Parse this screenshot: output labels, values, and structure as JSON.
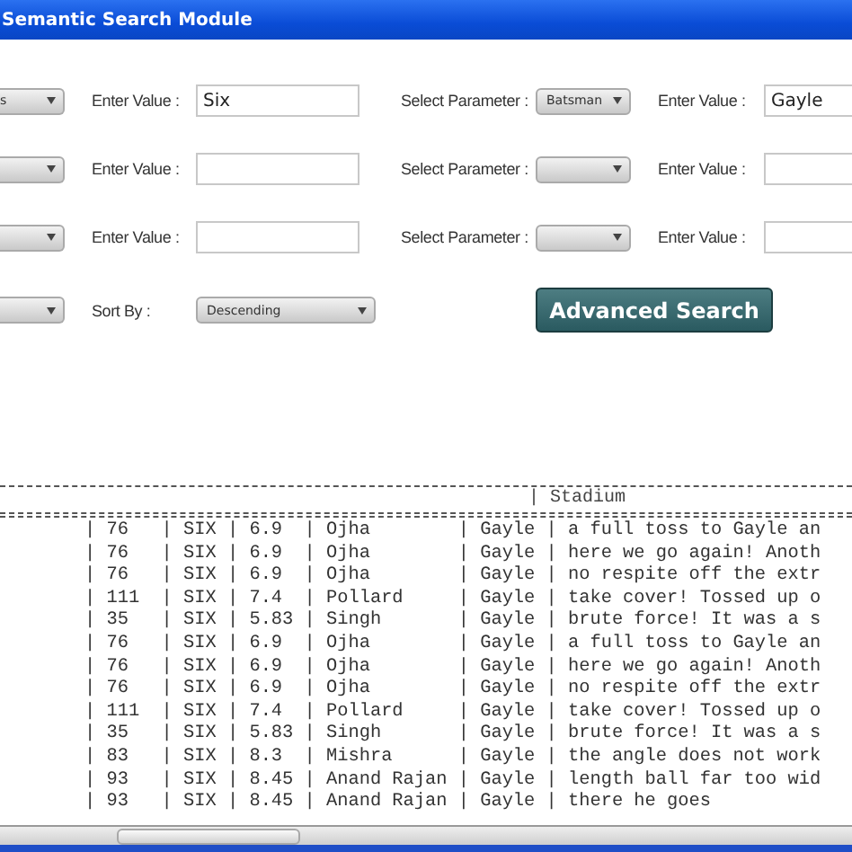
{
  "window": {
    "title": "Semantic Search Module"
  },
  "criteria_rows": [
    {
      "cells": [
        {
          "kind": "edge_dropdown",
          "value": "s"
        },
        {
          "kind": "label",
          "text": "Enter Value :"
        },
        {
          "kind": "input",
          "value": "Six"
        },
        {
          "kind": "label",
          "text": "Select Parameter :"
        },
        {
          "kind": "dropdown",
          "value": "Batsman"
        },
        {
          "kind": "label",
          "text": "Enter Value :"
        },
        {
          "kind": "input",
          "value": "Gayle"
        }
      ]
    },
    {
      "cells": [
        {
          "kind": "edge_dropdown"
        },
        {
          "kind": "label",
          "text": "Enter Value :"
        },
        {
          "kind": "input"
        },
        {
          "kind": "label",
          "text": "Select Parameter :"
        },
        {
          "kind": "dropdown"
        },
        {
          "kind": "label",
          "text": "Enter Value :"
        },
        {
          "kind": "input"
        }
      ]
    },
    {
      "cells": [
        {
          "kind": "edge_dropdown"
        },
        {
          "kind": "label",
          "text": "Enter Value :"
        },
        {
          "kind": "input"
        },
        {
          "kind": "label",
          "text": "Select Parameter :"
        },
        {
          "kind": "dropdown"
        },
        {
          "kind": "label",
          "text": "Enter Value :"
        },
        {
          "kind": "input"
        }
      ]
    },
    {
      "cells": [
        {
          "kind": "edge_dropdown"
        },
        {
          "kind": "label",
          "text": "Sort By :"
        },
        {
          "kind": "wide_dropdown",
          "value": "Descending"
        },
        {
          "kind": "spacer"
        },
        {
          "kind": "button",
          "text": "Advanced Search"
        }
      ]
    }
  ],
  "results": {
    "header": "| Stadium",
    "lines": [
      "| 76   | SIX | 6.9  | Ojha        | Gayle | a full toss to Gayle an",
      "| 76   | SIX | 6.9  | Ojha        | Gayle | here we go again! Anoth",
      "| 76   | SIX | 6.9  | Ojha        | Gayle | no respite off the extr",
      "| 111  | SIX | 7.4  | Pollard     | Gayle | take cover! Tossed up o",
      "| 35   | SIX | 5.83 | Singh       | Gayle | brute force! It was a s",
      "| 76   | SIX | 6.9  | Ojha        | Gayle | a full toss to Gayle an",
      "| 76   | SIX | 6.9  | Ojha        | Gayle | here we go again! Anoth",
      "| 76   | SIX | 6.9  | Ojha        | Gayle | no respite off the extr",
      "| 111  | SIX | 7.4  | Pollard     | Gayle | take cover! Tossed up o",
      "| 35   | SIX | 5.83 | Singh       | Gayle | brute force! It was a s",
      "| 83   | SIX | 8.3  | Mishra      | Gayle | the angle does not work",
      "| 93   | SIX | 8.45 | Anand Rajan | Gayle | length ball far too wid",
      "| 93   | SIX | 8.45 | Anand Rajan | Gayle | there he goes"
    ]
  }
}
